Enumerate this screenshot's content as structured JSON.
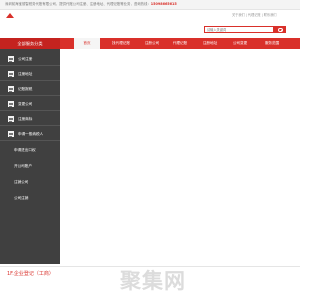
{
  "topbar": {
    "intro": "深圳前海宝德智税务代账有限公司，提供代账公司注册、注册地址、代理记账等业务，咨询热线：",
    "phone": "15098665615"
  },
  "user_links": "关于我们  |  代理记账  |  联系我们",
  "search": {
    "placeholder": "请输入关键词"
  },
  "nav": {
    "all_services": "全部服务分类",
    "items": [
      "首页",
      "找代理记账",
      "注册公司",
      "代理记账",
      "注册地址",
      "公司变更",
      "服务范围"
    ]
  },
  "panel": {
    "items": [
      {
        "label": "公司注册"
      },
      {
        "label": "注册地址"
      },
      {
        "label": "记账报税"
      },
      {
        "label": "变更公司"
      },
      {
        "label": "注册商标"
      },
      {
        "label": "申请一般纳税人"
      },
      {
        "label": "申请进出口权"
      },
      {
        "label": "开公司账户"
      },
      {
        "label": "注销公司"
      },
      {
        "label": "公司注销"
      }
    ]
  },
  "bottom": {
    "title": "1F.企业登记（工商）"
  },
  "watermark": "聚集网"
}
